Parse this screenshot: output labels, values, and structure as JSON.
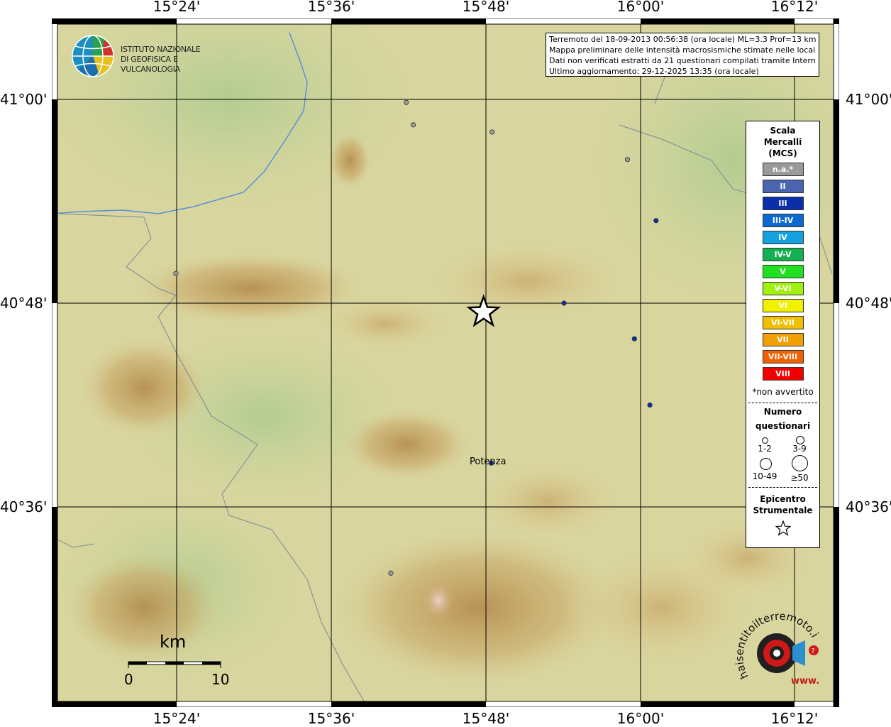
{
  "axes": {
    "longitude_ticks": [
      "15°24'",
      "15°36'",
      "15°48'",
      "16°00'",
      "16°12'"
    ],
    "latitude_ticks": [
      "41°00'",
      "40°48'",
      "40°36'"
    ]
  },
  "info_box": {
    "line1": "Terremoto del 18-09-2013 00:56:38 (ora locale) ML=3.3 Prof=13 km",
    "line2": "Mappa preliminare delle intensità macrosismiche stimate nelle località",
    "line3": "Dati non verificati estratti da 21 questionari compilati tramite Internet.",
    "line4": "Ultimo aggiornamento: 29-12-2025 13:35 (ora locale)"
  },
  "logo": {
    "line1": "ISTITUTO NAZIONALE",
    "line2": "DI GEOFISICA E VULCANOLOGIA"
  },
  "legend": {
    "title_line1": "Scala",
    "title_line2": "Mercalli",
    "title_line3": "(MCS)",
    "classes": [
      {
        "label": "n.a.*",
        "color": "#9a9a9a"
      },
      {
        "label": "II",
        "color": "#4a64b0"
      },
      {
        "label": "III",
        "color": "#0a2fa8"
      },
      {
        "label": "III-IV",
        "color": "#0a6ad0"
      },
      {
        "label": "IV",
        "color": "#15a0e0"
      },
      {
        "label": "IV-V",
        "color": "#15b050"
      },
      {
        "label": "V",
        "color": "#20e020"
      },
      {
        "label": "V-VI",
        "color": "#a0f010"
      },
      {
        "label": "VI",
        "color": "#f0f000"
      },
      {
        "label": "VI-VII",
        "color": "#f0c000"
      },
      {
        "label": "VII",
        "color": "#f0a000"
      },
      {
        "label": "VII-VIII",
        "color": "#f06000"
      },
      {
        "label": "VIII",
        "color": "#f00000"
      }
    ],
    "na_note": "*non avvertito",
    "questionnaires_title_line1": "Numero",
    "questionnaires_title_line2": "questionari",
    "size_labels": [
      "1-2",
      "3-9",
      "10-49",
      "≥50"
    ],
    "epicenter_title_line1": "Epicentro",
    "epicenter_title_line2": "Strumentale"
  },
  "place_label": "Potenza",
  "scale_bar": {
    "unit": "km",
    "start": "0",
    "end": "10"
  },
  "observations": [
    {
      "lon": 15.697,
      "lat": 40.997,
      "intensity": "n.a.*"
    },
    {
      "lon": 15.706,
      "lat": 40.975,
      "intensity": "n.a.*"
    },
    {
      "lon": 15.808,
      "lat": 40.968,
      "intensity": "n.a.*"
    },
    {
      "lon": 15.983,
      "lat": 40.941,
      "intensity": "n.a.*"
    },
    {
      "lon": 15.399,
      "lat": 40.829,
      "intensity": "n.a.*"
    },
    {
      "lon": 15.677,
      "lat": 40.535,
      "intensity": "n.a.*"
    },
    {
      "lon": 16.02,
      "lat": 40.881,
      "intensity": "III"
    },
    {
      "lon": 15.901,
      "lat": 40.8,
      "intensity": "III"
    },
    {
      "lon": 15.992,
      "lat": 40.765,
      "intensity": "III"
    },
    {
      "lon": 16.012,
      "lat": 40.7,
      "intensity": "III"
    },
    {
      "lon": 15.807,
      "lat": 40.643,
      "intensity": "III"
    }
  ],
  "epicenter": {
    "lon": 15.797,
    "lat": 40.791
  },
  "hsit_logo": {
    "text": "haisentitoilterremoto.it",
    "www": "www."
  }
}
